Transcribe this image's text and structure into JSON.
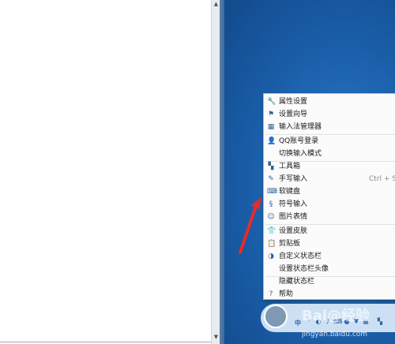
{
  "menu": {
    "items": [
      {
        "icon": "wrench-icon",
        "glyph": "🔧",
        "label": "属性设置"
      },
      {
        "icon": "flag-icon",
        "glyph": "⚑",
        "label": "设置向导"
      },
      {
        "icon": "grid-square-icon",
        "glyph": "▦",
        "label": "输入法管理器"
      },
      {
        "icon": "user-icon",
        "glyph": "👤",
        "label": "QQ账号登录"
      },
      {
        "icon": "",
        "glyph": "",
        "label": "切换输入模式"
      },
      {
        "icon": "toolbox-icon",
        "glyph": "▚",
        "label": "工具箱"
      },
      {
        "icon": "pen-icon",
        "glyph": "✎",
        "label": "手写输入",
        "shortcut": "Ctrl + Sh"
      },
      {
        "icon": "keyboard-icon",
        "glyph": "⌨",
        "label": "软键盘"
      },
      {
        "icon": "symbol-icon",
        "glyph": "§",
        "label": "符号输入"
      },
      {
        "icon": "smiley-icon",
        "glyph": "☺",
        "label": "图片表情"
      },
      {
        "icon": "tshirt-icon",
        "glyph": "👕",
        "label": "设置皮肤"
      },
      {
        "icon": "clipboard-icon",
        "glyph": "📋",
        "label": "剪贴板"
      },
      {
        "icon": "palette-icon",
        "glyph": "◑",
        "label": "自定义状态栏"
      },
      {
        "icon": "",
        "glyph": "",
        "label": "设置状态栏头像"
      },
      {
        "icon": "",
        "glyph": "",
        "label": "隐藏状态栏"
      },
      {
        "icon": "help-icon",
        "glyph": "?",
        "label": "帮助"
      }
    ]
  },
  "ime_bar": {
    "mode_label": "中",
    "watermark": "Bai@经验",
    "watermark_url": "jingyan.baidu.com"
  },
  "colors": {
    "desktop": "#1a5ea8",
    "arrow": "#e52b2b",
    "menu_background": "#fbfbfb"
  }
}
